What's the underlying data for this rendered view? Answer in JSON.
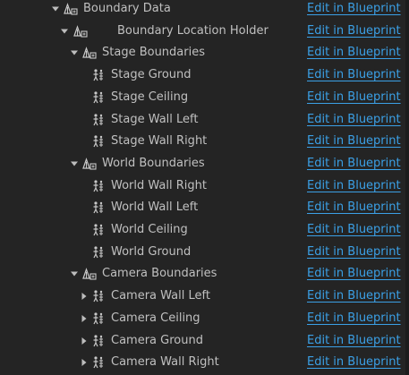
{
  "outliner": {
    "link_label": "Edit in Blueprint",
    "rows": [
      {
        "label": "Boundary Data",
        "depth": 0,
        "expander": "expanded",
        "icon": "component-group-icon"
      },
      {
        "label": "Boundary Location Holder",
        "depth": 1,
        "expander": "expanded",
        "icon": "component-group-icon"
      },
      {
        "label": "Stage Boundaries",
        "depth": 2,
        "expander": "expanded",
        "icon": "component-group-icon"
      },
      {
        "label": "Stage Ground",
        "depth": 3,
        "expander": "none",
        "icon": "scene-component-icon"
      },
      {
        "label": "Stage Ceiling",
        "depth": 3,
        "expander": "none",
        "icon": "scene-component-icon"
      },
      {
        "label": "Stage Wall Left",
        "depth": 3,
        "expander": "none",
        "icon": "scene-component-icon"
      },
      {
        "label": "Stage Wall Right",
        "depth": 3,
        "expander": "none",
        "icon": "scene-component-icon"
      },
      {
        "label": "World Boundaries",
        "depth": 2,
        "expander": "expanded",
        "icon": "component-group-icon"
      },
      {
        "label": "World Wall Right",
        "depth": 3,
        "expander": "none",
        "icon": "scene-component-icon"
      },
      {
        "label": "World Wall Left",
        "depth": 3,
        "expander": "none",
        "icon": "scene-component-icon"
      },
      {
        "label": "World Ceiling",
        "depth": 3,
        "expander": "none",
        "icon": "scene-component-icon"
      },
      {
        "label": "World Ground",
        "depth": 3,
        "expander": "none",
        "icon": "scene-component-icon"
      },
      {
        "label": "Camera Boundaries",
        "depth": 2,
        "expander": "expanded",
        "icon": "component-group-icon"
      },
      {
        "label": "Camera Wall Left",
        "depth": 3,
        "expander": "collapsed",
        "icon": "scene-component-icon"
      },
      {
        "label": "Camera Ceiling",
        "depth": 3,
        "expander": "collapsed",
        "icon": "scene-component-icon"
      },
      {
        "label": "Camera Ground",
        "depth": 3,
        "expander": "collapsed",
        "icon": "scene-component-icon"
      },
      {
        "label": "Camera Wall Right",
        "depth": 3,
        "expander": "collapsed",
        "icon": "scene-component-icon"
      }
    ]
  },
  "colors": {
    "background": "#242424",
    "text": "#c0c0c0",
    "link": "#3ba0e6",
    "icon": "#c8c8c8"
  }
}
